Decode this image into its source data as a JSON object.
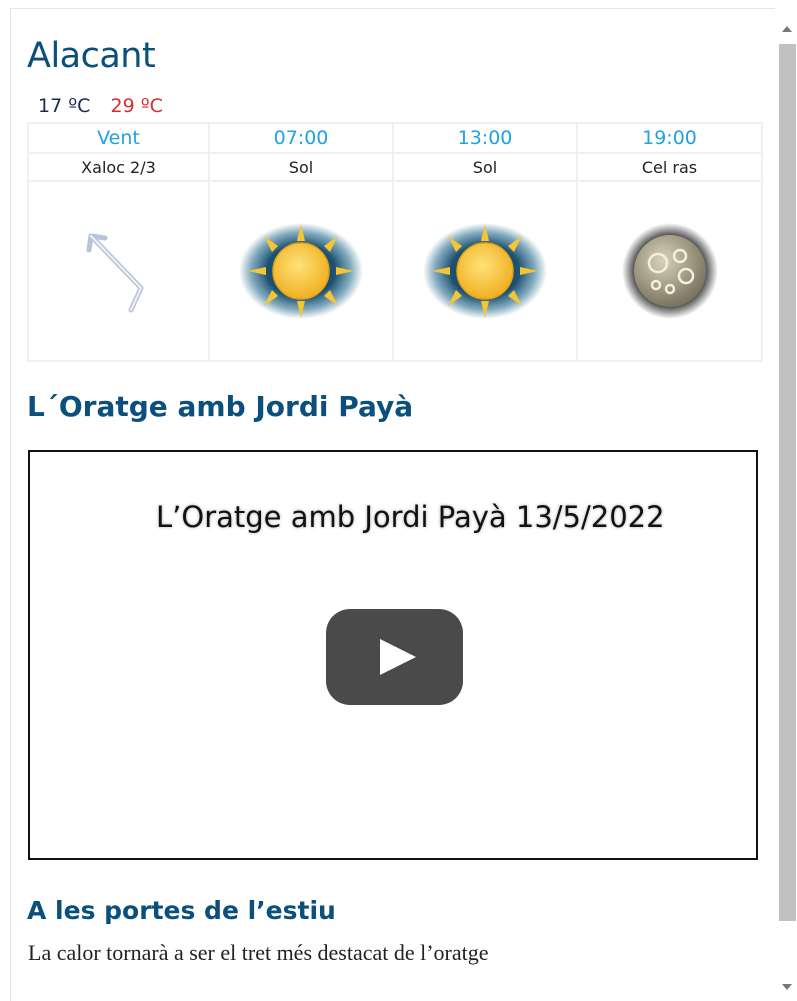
{
  "city": "Alacant",
  "temps": {
    "min": "17 ºC",
    "max": "29 ºC"
  },
  "forecast": {
    "headers": [
      "Vent",
      "07:00",
      "13:00",
      "19:00"
    ],
    "descriptions": [
      "Xaloc 2/3",
      "Sol",
      "Sol",
      "Cel ras"
    ],
    "icons": [
      "wind-arrow-icon",
      "sun-icon",
      "sun-icon",
      "moon-icon"
    ]
  },
  "section_title": "L´Oratge amb Jordi Payà",
  "video": {
    "title": "L’Oratge amb Jordi Payà 13/5/2022"
  },
  "article": {
    "title": "A les portes de l’estiu",
    "text": "La calor tornarà a ser el tret més destacat de l’oratge"
  },
  "colors": {
    "heading": "#0b4f7c",
    "header_accent": "#1fa3de",
    "max_temp": "#d62f2f"
  }
}
